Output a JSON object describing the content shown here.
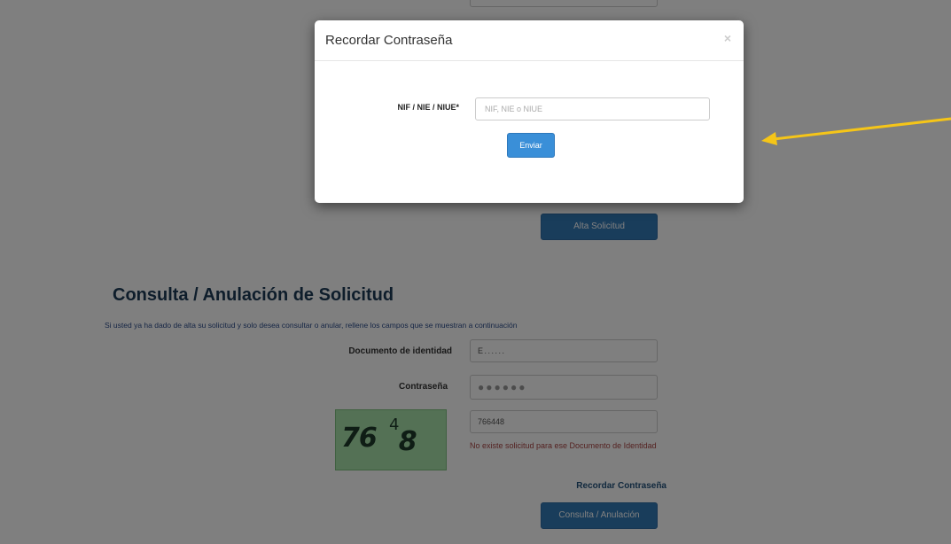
{
  "background_page": {
    "alta_button": "Alta Solicitud",
    "section_title": "Consulta / Anulación de Solicitud",
    "section_description": "Si usted ya ha dado de alta su solicitud y solo desea consultar o anular, rellene los campos que se muestran a continuación",
    "doc_label": "Documento de identidad",
    "doc_value": "E . . . . . .",
    "password_label": "Contraseña",
    "password_value": "●●●●●●",
    "captcha_image_text": "76",
    "captcha_image_sup": "4",
    "captcha_image_tail": " 8",
    "captcha_input_value": "766448",
    "error_message": "No existe solicitud para ese Documento de Identidad",
    "recordar_link": "Recordar Contraseña",
    "consulta_button": "Consulta / Anulación"
  },
  "modal": {
    "title": "Recordar Contraseña",
    "close_symbol": "×",
    "field_label": "NIF / NIE / NIUE*",
    "field_placeholder": "NIF, NIE o NIUE",
    "submit_button": "Enviar"
  },
  "colors": {
    "annotation_arrow": "#f5c518",
    "primary_button": "#337ab7",
    "section_title": "#1c3a57"
  }
}
